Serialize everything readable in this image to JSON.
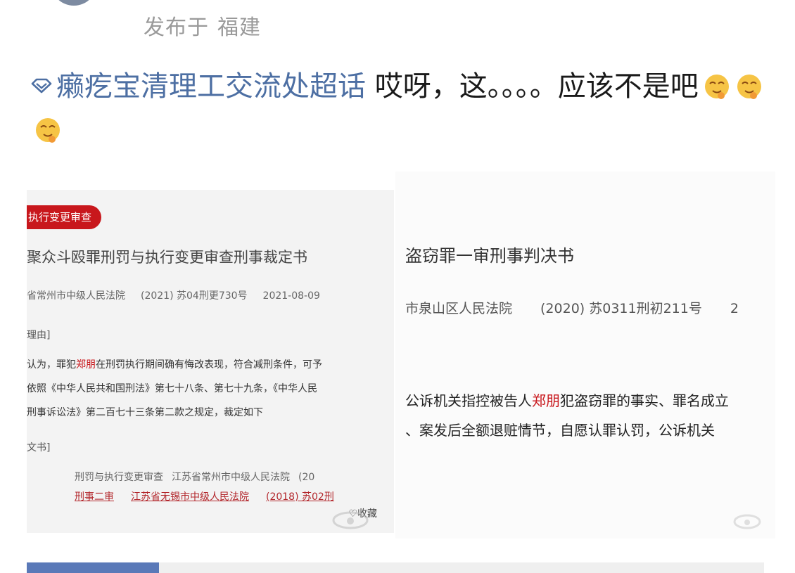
{
  "post": {
    "meta_prefix": "发布于",
    "location": "福建",
    "topic": "癞疙宝清理工交流处超话",
    "text": "哎呀，这。。。。应该不是吧"
  },
  "card_left": {
    "tag": "执行变更审查",
    "title_mark": "",
    "title": "聚众斗殴罪刑罚与执行变更审查刑事裁定书",
    "court": "省常州市中级人民法院",
    "case_no": "(2021) 苏04刑更730号",
    "date": "2021-08-09",
    "section_reason": "理由]",
    "lines": [
      {
        "pre": "认为，罪犯",
        "name": "郑朋",
        "post": "在刑罚执行期间确有悔改表现，符合减刑条件，可予"
      },
      {
        "pre": "依照《中华人民共和国刑法》第七十八条、第七十九条，《中华人民",
        "name": "",
        "post": ""
      },
      {
        "pre": "刑事诉讼法》第二百七十三条第二款之规定，裁定如下",
        "name": "",
        "post": ""
      }
    ],
    "section_docs": "文书]",
    "related_gray": [
      "刑罚与执行变更审查",
      "江苏省常州市中级人民法院",
      "(20"
    ],
    "related_red": [
      "刑事二审",
      "江苏省无锡市中级人民法院",
      "(2018) 苏02刑"
    ],
    "favorite": "♡收藏"
  },
  "card_right": {
    "title": "盗窃罪一审刑事判决书",
    "court": "市泉山区人民法院",
    "case_no": "(2020) 苏0311刑初211号",
    "trail": "2",
    "line1": {
      "pre": "公诉机关指控被告人",
      "name": "郑朋",
      "post": "犯盗窃罪的事实、罪名成立"
    },
    "line2": "、案发后全额退赃情节，自愿认罪认罚，公诉机关"
  },
  "colors": {
    "topic": "#4d6fa3",
    "tag_bg": "#c8171c",
    "name_highlight": "#c8171c",
    "avatar": "#7d8ba1"
  },
  "icons": {
    "topic": "topic-diamond-icon",
    "emoji": "drooling-face-emoji",
    "watermark": "weibo-watermark-icon"
  }
}
